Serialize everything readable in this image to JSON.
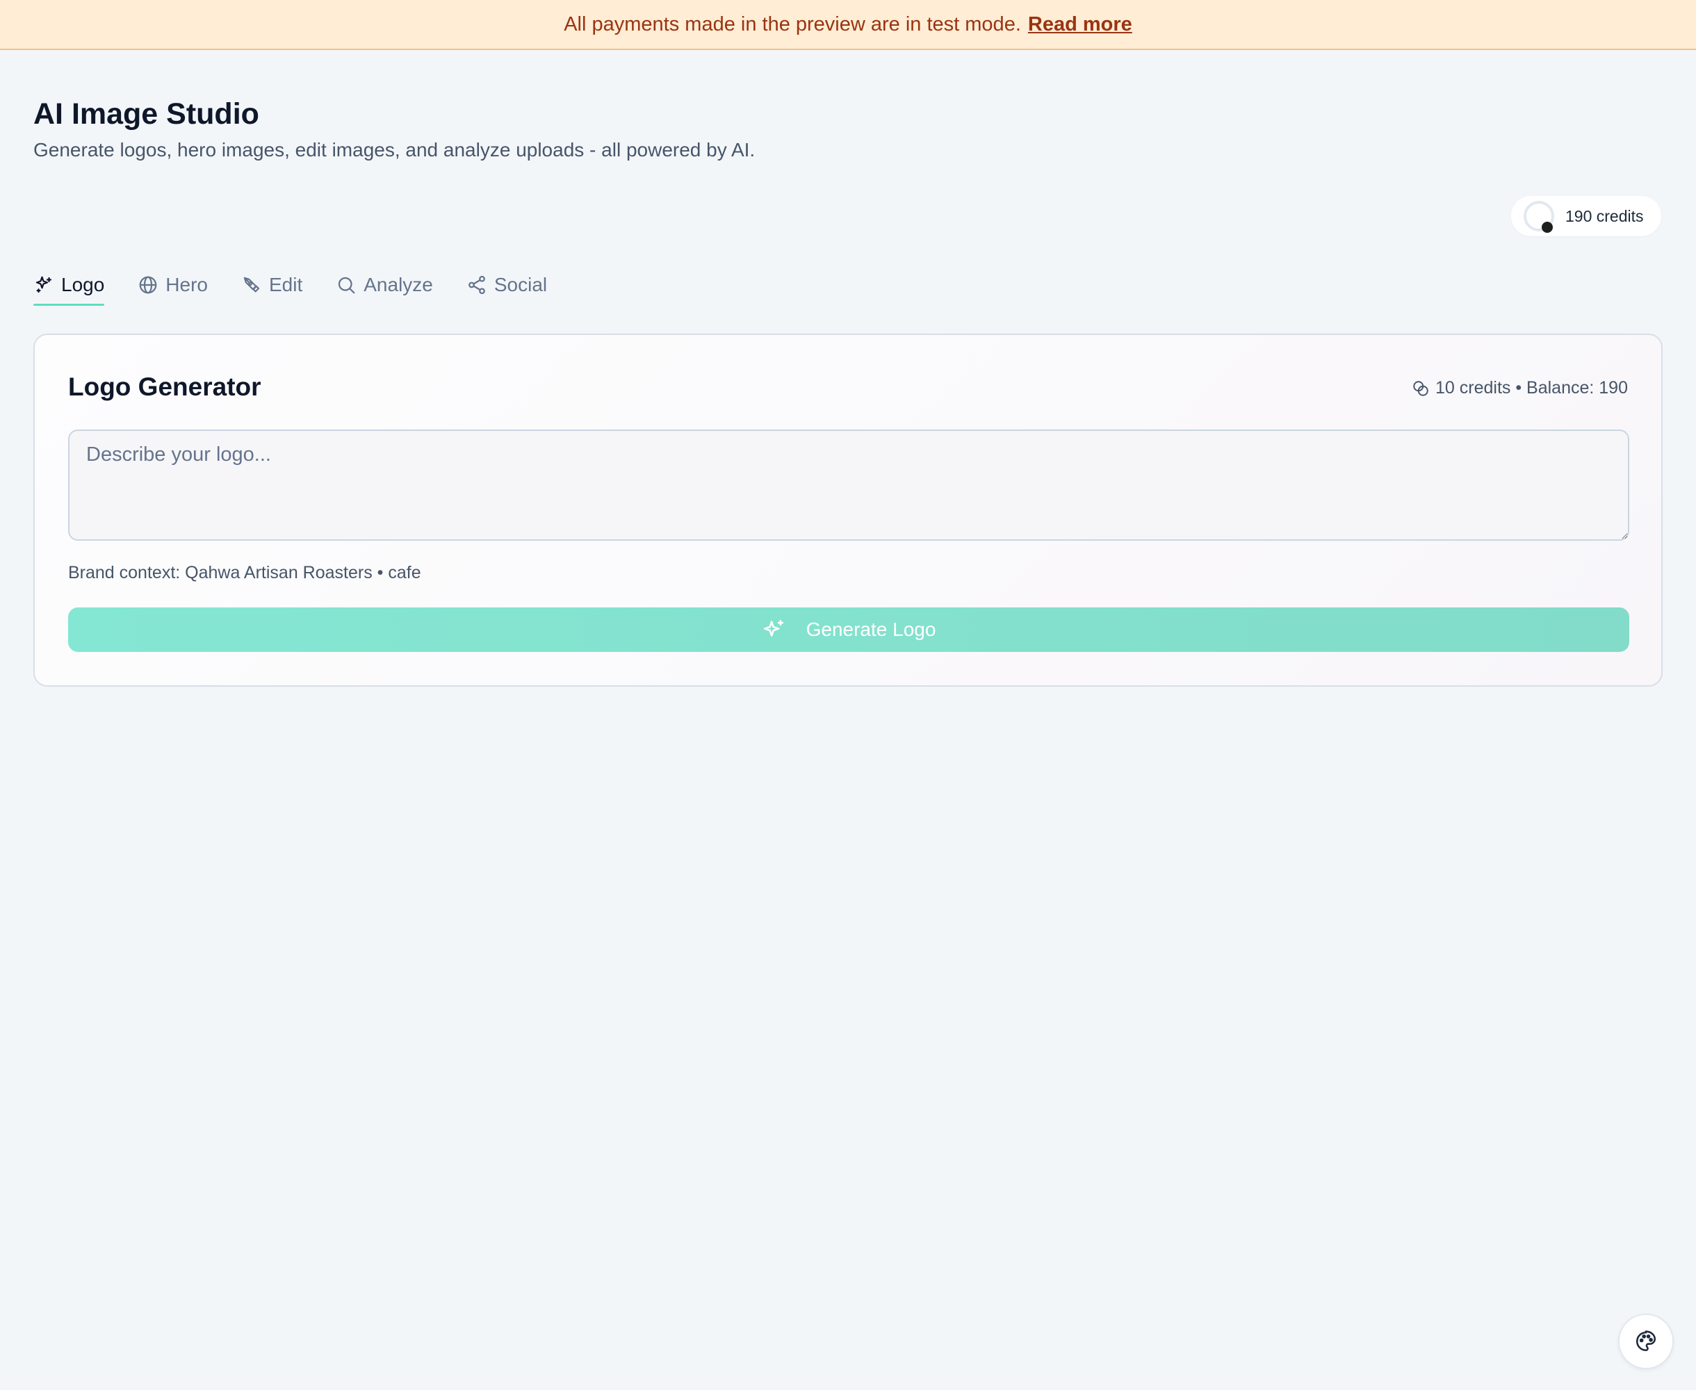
{
  "banner": {
    "text": "All payments made in the preview are in test mode.",
    "link_label": "Read more"
  },
  "header": {
    "title": "AI Image Studio",
    "subtitle": "Generate logos, hero images, edit images, and analyze uploads - all powered by AI."
  },
  "credits_pill": {
    "label": "190 credits"
  },
  "tabs": [
    {
      "label": "Logo",
      "icon": "sparkles-icon",
      "active": true
    },
    {
      "label": "Hero",
      "icon": "globe-icon",
      "active": false
    },
    {
      "label": "Edit",
      "icon": "pen-tool-icon",
      "active": false
    },
    {
      "label": "Analyze",
      "icon": "search-icon",
      "active": false
    },
    {
      "label": "Social",
      "icon": "share-icon",
      "active": false
    }
  ],
  "card": {
    "title": "Logo Generator",
    "cost": "10 credits • Balance: 190",
    "prompt_placeholder": "Describe your logo...",
    "prompt_value": "",
    "brand_context": "Brand context: Qahwa Artisan Roasters • cafe",
    "generate_label": "Generate Logo"
  },
  "colors": {
    "accent": "#5eddc0",
    "banner_bg": "#ffedd5",
    "banner_text": "#9a3412",
    "button": "#84e7d3"
  },
  "floating": {
    "icon": "palette-icon"
  }
}
